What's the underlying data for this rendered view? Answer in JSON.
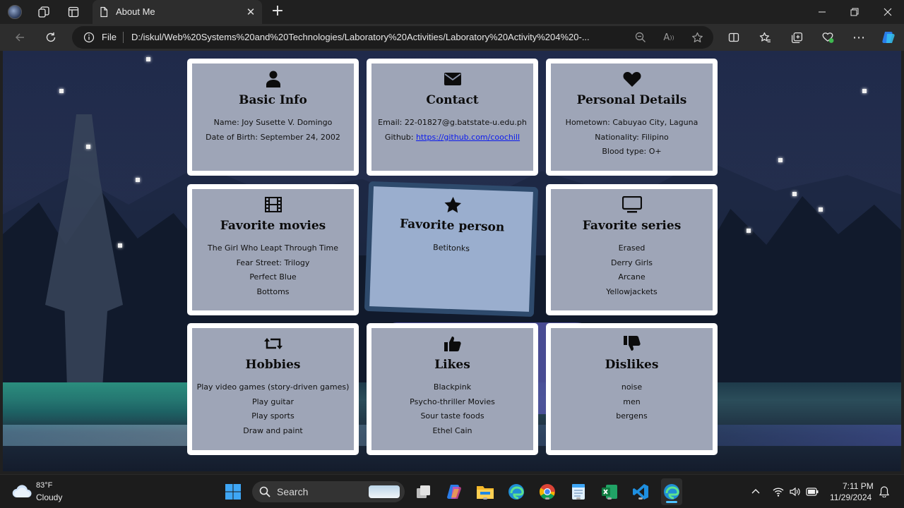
{
  "browser": {
    "tab_title": "About Me",
    "file_label": "File",
    "url": "D:/iskul/Web%20Systems%20and%20Technologies/Laboratory%20Activities/Laboratory%20Activity%204%20-..."
  },
  "cards": {
    "basic_info": {
      "icon": "user-icon",
      "title": "Basic Info",
      "lines": [
        "Name: Joy Susette V. Domingo",
        "Date of Birth: September 24, 2002"
      ]
    },
    "contact": {
      "icon": "envelope-icon",
      "title": "Contact",
      "email": "Email: 22-01827@g.batstate-u.edu.ph",
      "github_prefix": "Github: ",
      "github_link": "https://github.com/coochill"
    },
    "personal_details": {
      "icon": "heart-icon",
      "title": "Personal Details",
      "lines": [
        "Hometown: Cabuyao City, Laguna",
        "Nationality: Filipino",
        "Blood type: O+"
      ]
    },
    "favorite_movies": {
      "icon": "film-icon",
      "title": "Favorite movies",
      "lines": [
        "The Girl Who Leapt Through Time",
        "Fear Street: Trilogy",
        "Perfect Blue",
        "Bottoms"
      ]
    },
    "favorite_person": {
      "icon": "star-icon",
      "title": "Favorite person",
      "lines": [
        "Betitonks"
      ]
    },
    "favorite_series": {
      "icon": "tv-icon",
      "title": "Favorite series",
      "lines": [
        "Erased",
        "Derry Girls",
        "Arcane",
        "Yellowjackets"
      ]
    },
    "hobbies": {
      "icon": "retweet-icon",
      "title": "Hobbies",
      "lines": [
        "Play video games (story-driven games)",
        "Play guitar",
        "Play sports",
        "Draw and paint"
      ]
    },
    "likes": {
      "icon": "thumbs-up-icon",
      "title": "Likes",
      "lines": [
        "Blackpink",
        "Psycho-thriller Movies",
        "Sour taste foods",
        "Ethel Cain"
      ]
    },
    "dislikes": {
      "icon": "thumbs-down-icon",
      "title": "Dislikes",
      "lines": [
        "noise",
        "men",
        "bergens"
      ]
    }
  },
  "taskbar": {
    "temperature": "83°F",
    "weather": "Cloudy",
    "search_label": "Search",
    "time": "7:11 PM",
    "date": "11/29/2024"
  },
  "colors": {
    "accent": "#4cc2ff",
    "link": "#0b1aee",
    "card_border": "#ffffff"
  }
}
